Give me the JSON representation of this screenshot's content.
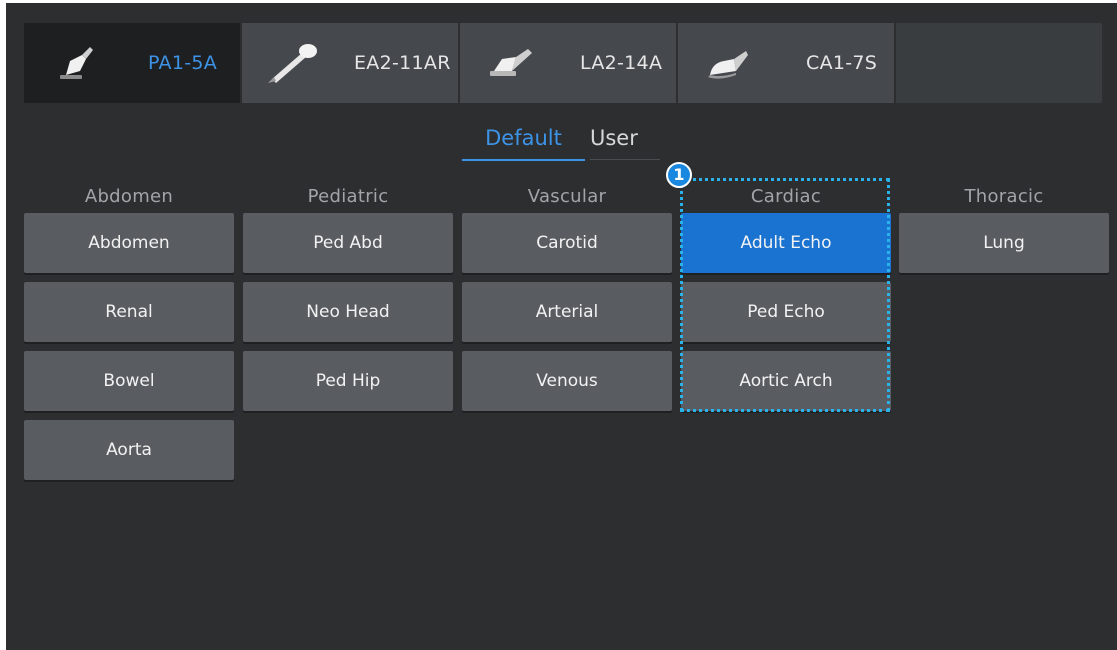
{
  "probes": [
    {
      "label": "PA1-5A",
      "active": true,
      "icon": "phased-array-probe-icon"
    },
    {
      "label": "EA2-11AR",
      "active": false,
      "icon": "endocavity-probe-icon"
    },
    {
      "label": "LA2-14A",
      "active": false,
      "icon": "linear-probe-icon"
    },
    {
      "label": "CA1-7S",
      "active": false,
      "icon": "convex-probe-icon"
    }
  ],
  "preset_tabs": {
    "default_label": "Default",
    "user_label": "User",
    "active": "Default"
  },
  "categories": [
    {
      "title": "Abdomen",
      "presets": [
        "Abdomen",
        "Renal",
        "Bowel",
        "Aorta"
      ]
    },
    {
      "title": "Pediatric",
      "presets": [
        "Ped Abd",
        "Neo Head",
        "Ped Hip"
      ]
    },
    {
      "title": "Vascular",
      "presets": [
        "Carotid",
        "Arterial",
        "Venous"
      ]
    },
    {
      "title": "Cardiac",
      "presets": [
        "Adult Echo",
        "Ped Echo",
        "Aortic Arch"
      ]
    },
    {
      "title": "Thoracic",
      "presets": [
        "Lung"
      ]
    }
  ],
  "selected_preset": "Adult Echo",
  "callout": {
    "number": "1"
  },
  "colors": {
    "accent": "#3d93e6",
    "selected_button": "#1a73d0",
    "callout": "#29b3ea",
    "background": "#2c2e30",
    "button": "#595d61"
  }
}
